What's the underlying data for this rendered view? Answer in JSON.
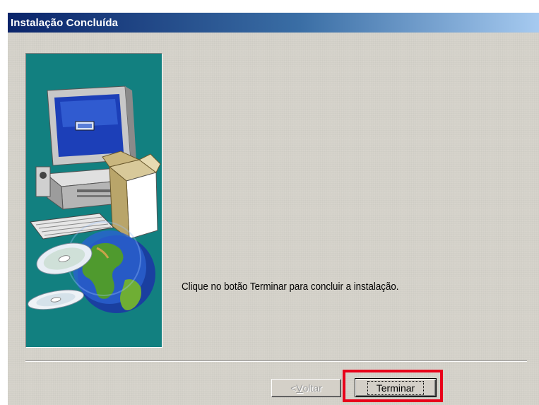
{
  "window": {
    "title": "Instalação Concluída"
  },
  "message": "Clique no botão Terminar para concluir a instalação.",
  "buttons": {
    "back_prefix": "< ",
    "back_accel": "V",
    "back_rest": "oltar",
    "back_enabled": false,
    "finish_label": "Terminar"
  },
  "illustration": {
    "icons": [
      "computer-icon",
      "software-box-icon",
      "cd-discs-icon",
      "globe-icon"
    ]
  },
  "colors": {
    "panel_teal": "#128080",
    "highlight_red": "#e8001a",
    "title_gradient_start": "#0a246a",
    "title_gradient_end": "#a6caf0"
  }
}
